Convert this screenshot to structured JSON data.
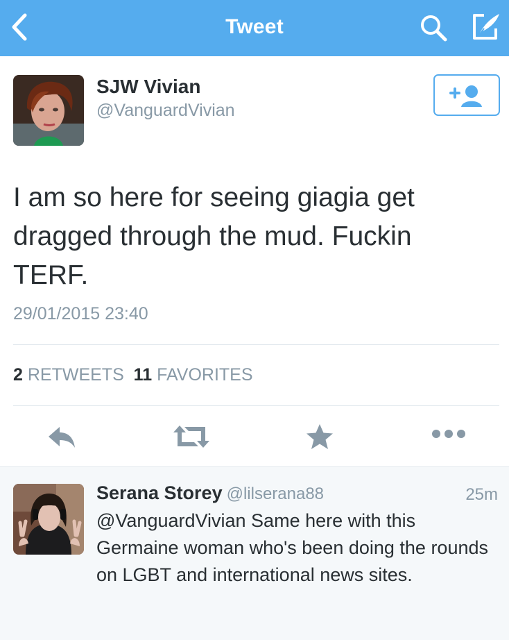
{
  "header": {
    "title": "Tweet",
    "background": "#55acee",
    "back_icon": "chevron-left-icon",
    "search_icon": "search-icon",
    "compose_icon": "compose-icon"
  },
  "tweet": {
    "author_name": "SJW Vivian",
    "author_handle": "@VanguardVivian",
    "follow_icon": "add-user-icon",
    "text": "I am so here for seeing giagia get dragged through the mud. Fuckin TERF.",
    "timestamp": "29/01/2015 23:40",
    "retweets_count": "2",
    "retweets_label": "RETWEETS",
    "favorites_count": "11",
    "favorites_label": "FAVORITES",
    "actions": [
      "reply-icon",
      "retweet-icon",
      "favorite-icon",
      "more-icon"
    ]
  },
  "reply": {
    "author_name": "Serana Storey",
    "author_handle": "@lilserana88",
    "time": "25m",
    "text": "@VanguardVivian Same here with this Germaine woman who's been doing the rounds on LGBT and international news sites."
  },
  "colors": {
    "accent": "#55acee",
    "text_primary": "#292f33",
    "text_secondary": "#8899a6",
    "divider": "#e1e8ed",
    "reply_background": "#f5f8fa"
  }
}
